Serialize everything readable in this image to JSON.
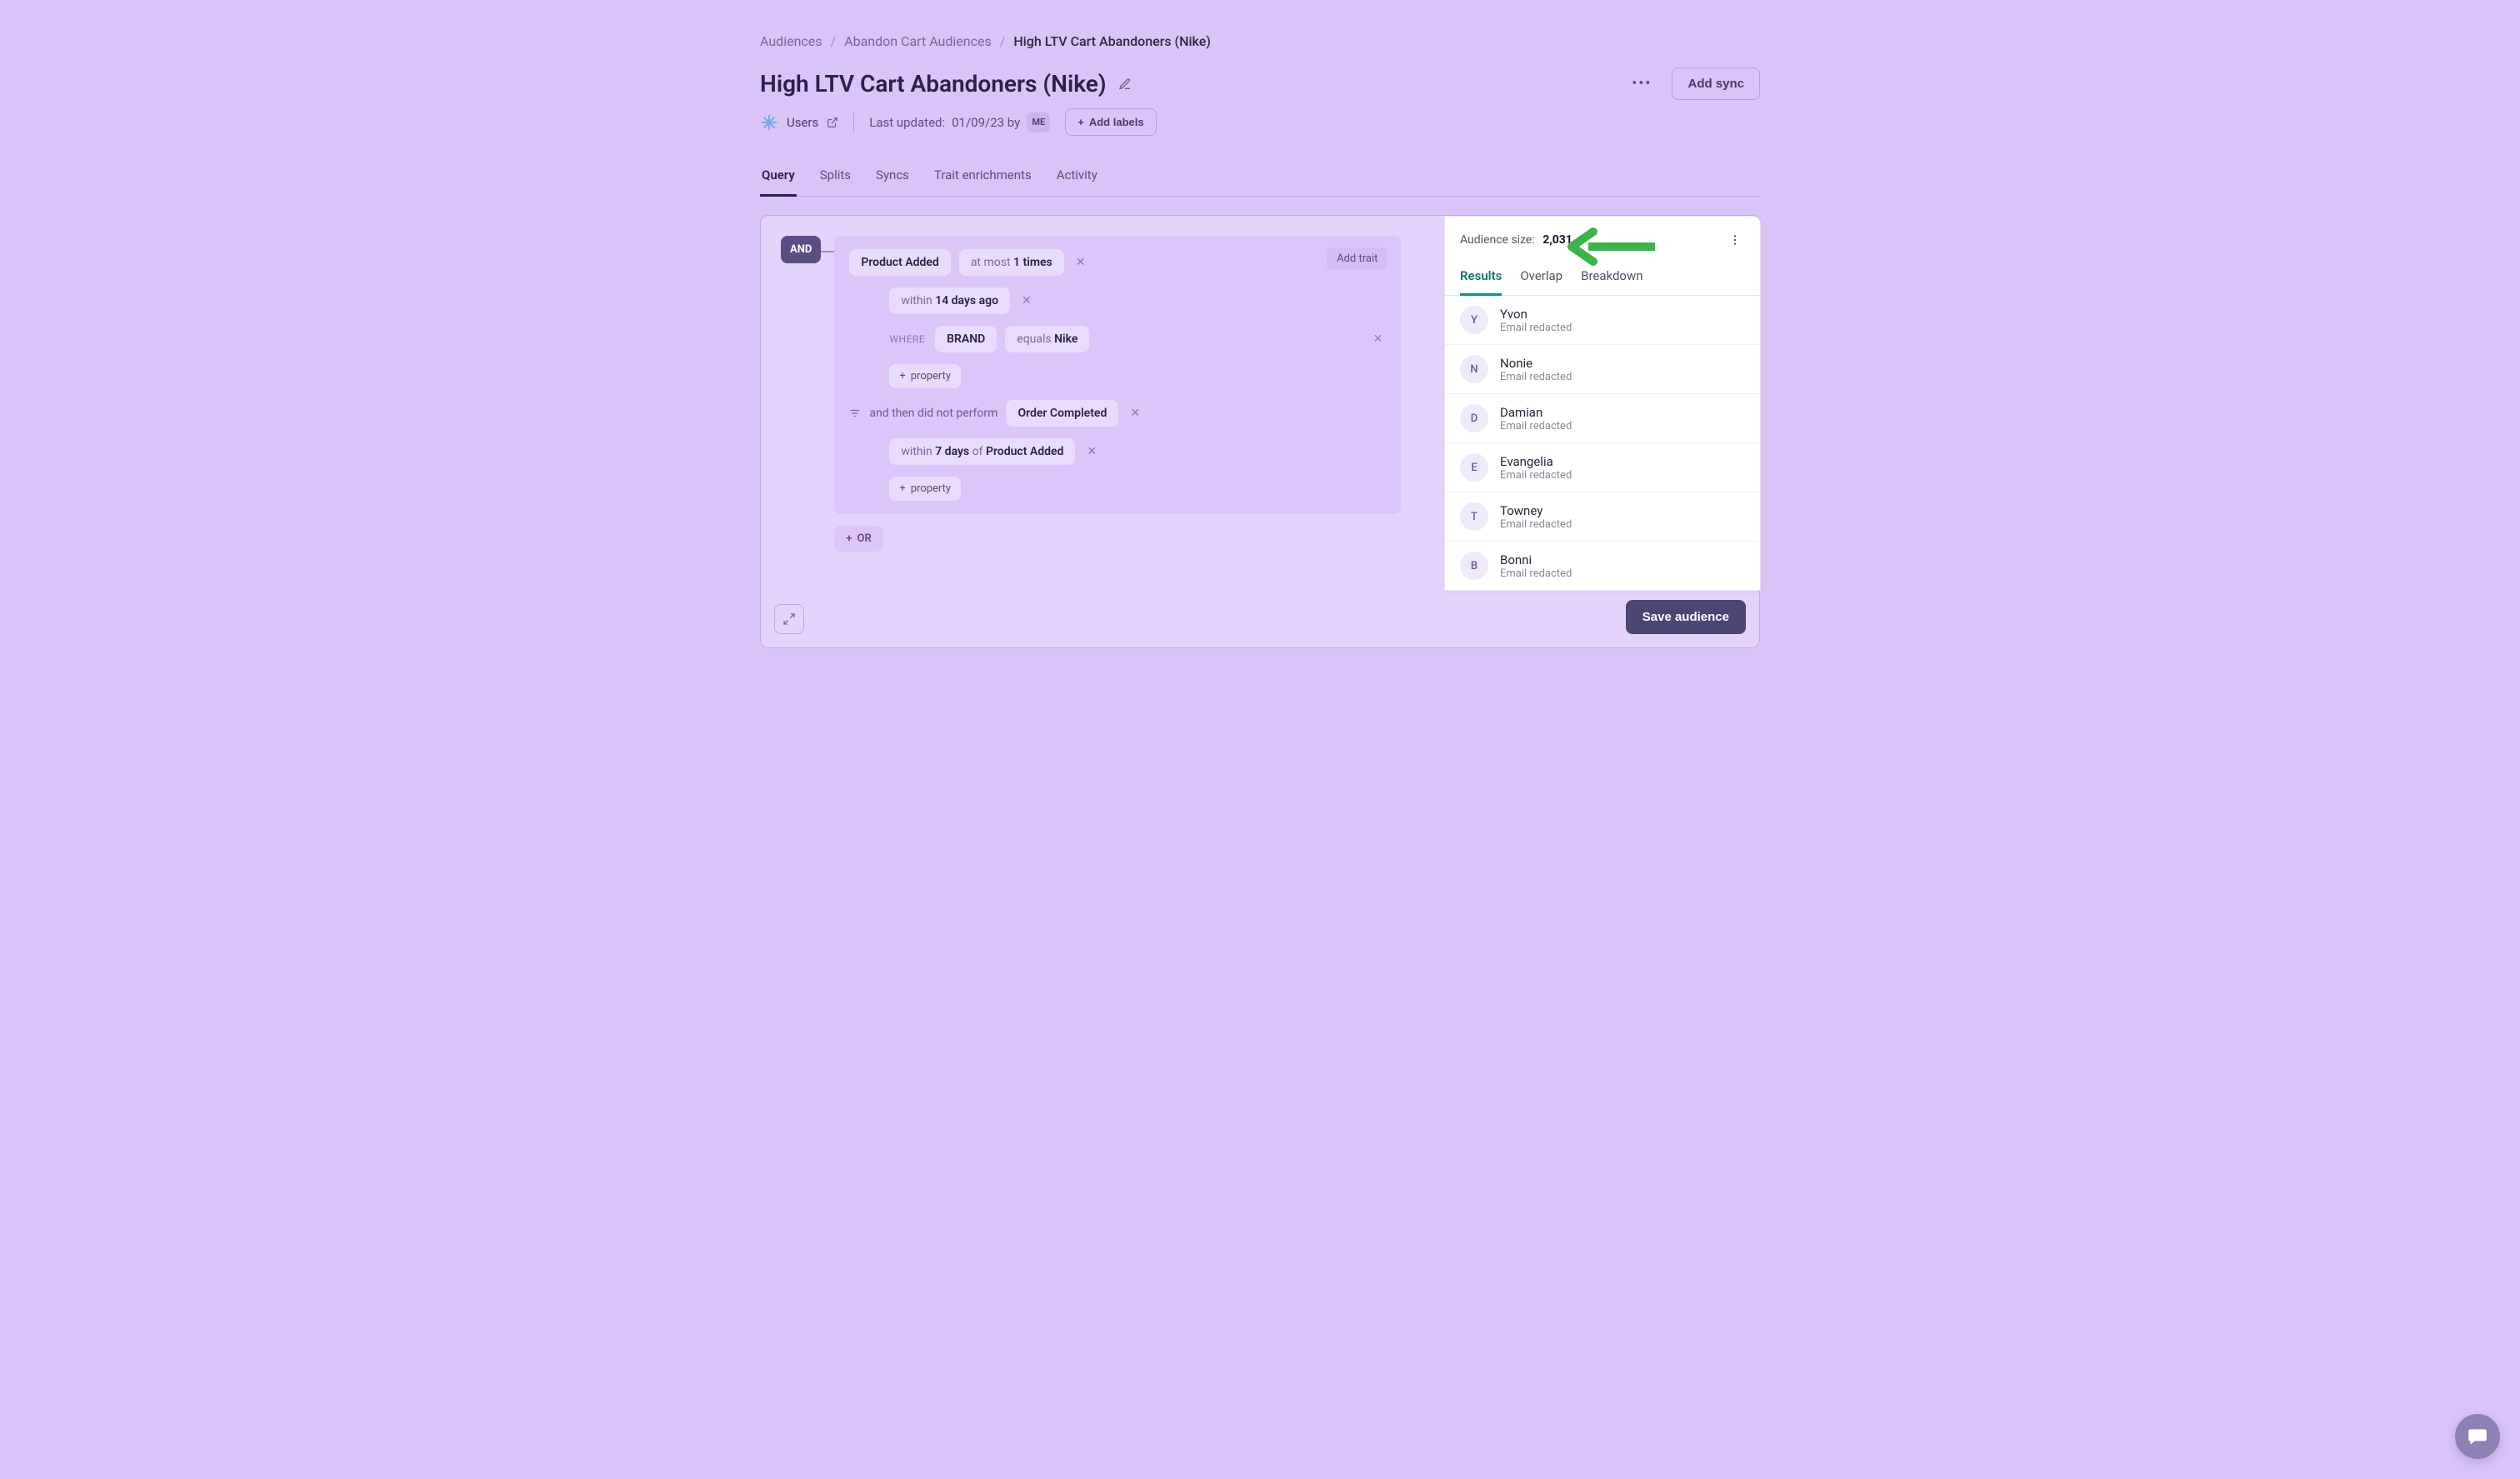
{
  "breadcrumb": {
    "root": "Audiences",
    "parent": "Abandon Cart Audiences",
    "current": "High LTV Cart Abandoners (Nike)"
  },
  "header": {
    "title": "High LTV Cart Abandoners (Nike)",
    "add_sync": "Add sync",
    "model_label": "Users",
    "last_updated_prefix": "Last updated:",
    "last_updated_value": "01/09/23 by",
    "editor_badge": "ME",
    "add_labels": "Add labels"
  },
  "tabs": {
    "items": [
      "Query",
      "Splits",
      "Syncs",
      "Trait enrichments",
      "Activity"
    ],
    "active": 0
  },
  "builder": {
    "and": "AND",
    "or": "OR",
    "add_trait": "Add trait",
    "event1": {
      "name": "Product Added",
      "count_prefix": "at most",
      "count_value": "1 times",
      "time_prefix": "within",
      "time_value": "14 days ago",
      "where": "WHERE",
      "prop_name": "BRAND",
      "prop_op": "equals",
      "prop_val": "Nike",
      "add_property": "property"
    },
    "funnel": {
      "label": "and then did not perform",
      "event": "Order Completed",
      "time_prefix": "within",
      "time_value": "7 days",
      "of": "of",
      "ref_event": "Product Added",
      "add_property": "property"
    },
    "save": "Save audience"
  },
  "preview": {
    "size_label": "Audience size:",
    "size_value": "2,031",
    "tabs": [
      "Results",
      "Overlap",
      "Breakdown"
    ],
    "active_tab": 0,
    "results": [
      {
        "initial": "Y",
        "name": "Yvon",
        "email": "Email redacted"
      },
      {
        "initial": "N",
        "name": "Nonie",
        "email": "Email redacted"
      },
      {
        "initial": "D",
        "name": "Damian",
        "email": "Email redacted"
      },
      {
        "initial": "E",
        "name": "Evangelia",
        "email": "Email redacted"
      },
      {
        "initial": "T",
        "name": "Towney",
        "email": "Email redacted"
      },
      {
        "initial": "B",
        "name": "Bonni",
        "email": "Email redacted"
      }
    ]
  }
}
